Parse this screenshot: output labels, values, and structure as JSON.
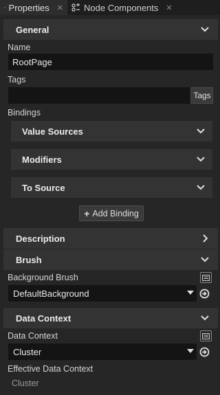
{
  "tabs": [
    {
      "label": "Properties",
      "icon": "list-icon",
      "active": true
    },
    {
      "label": "Node Components",
      "icon": "components-icon",
      "active": false
    }
  ],
  "sections": {
    "general": "General",
    "description": "Description",
    "brush": "Brush",
    "data_context": "Data Context"
  },
  "fields": {
    "name_label": "Name",
    "name_value": "RootPage",
    "tags_label": "Tags",
    "tags_value": "",
    "tags_button": "Tags",
    "bindings_label": "Bindings"
  },
  "bindings": {
    "value_sources": "Value Sources",
    "modifiers": "Modifiers",
    "to_source": "To Source",
    "add_binding": "Add Binding"
  },
  "brush": {
    "background_label": "Background Brush",
    "background_value": "DefaultBackground"
  },
  "data_context": {
    "label": "Data Context",
    "value": "Cluster",
    "effective_label": "Effective Data Context",
    "effective_value": "Cluster"
  },
  "colors": {
    "panel_bg": "#262626",
    "header_bg": "#333333",
    "input_bg": "#141414"
  }
}
